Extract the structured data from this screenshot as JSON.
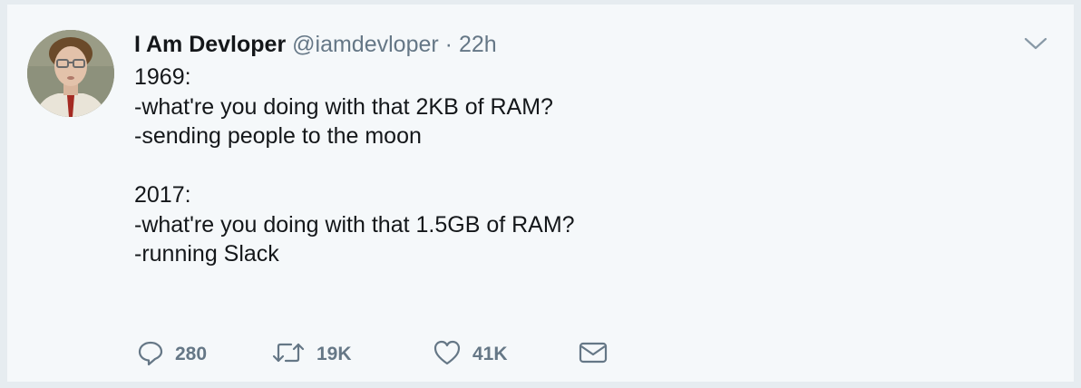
{
  "tweet": {
    "author_name": "I Am Devloper",
    "author_handle": "@iamdevloper",
    "separator": "·",
    "timestamp": "22h",
    "lines": [
      "1969:",
      "-what're you doing with that 2KB of RAM?",
      "-sending people to the moon",
      "",
      "2017:",
      "-what're you doing with that 1.5GB of RAM?",
      "-running Slack"
    ]
  },
  "actions": {
    "reply_count": "280",
    "retweet_count": "19K",
    "like_count": "41K"
  },
  "icons": {
    "menu": "chevron-down-icon",
    "reply": "reply-icon",
    "retweet": "retweet-icon",
    "like": "heart-icon",
    "dm": "envelope-icon"
  },
  "colors": {
    "icon_gray": "#657786",
    "text": "#14171a",
    "background": "#f5f8fa"
  }
}
